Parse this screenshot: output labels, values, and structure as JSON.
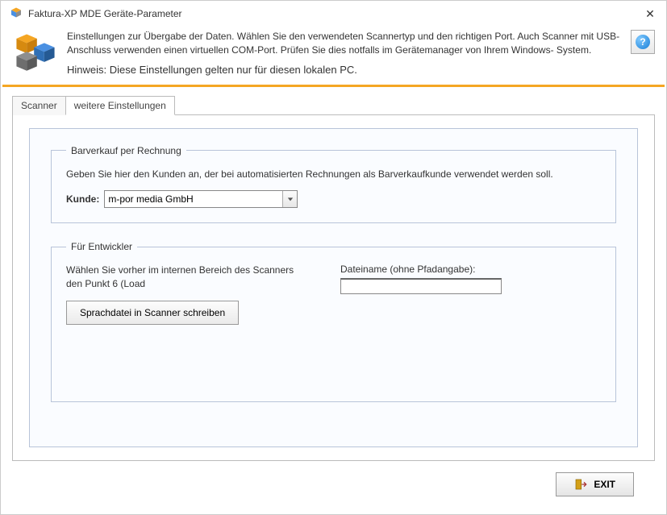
{
  "window": {
    "title": "Faktura-XP MDE Geräte-Parameter"
  },
  "header": {
    "desc": "Einstellungen zur Übergabe der Daten. Wählen Sie den verwendeten Scannertyp und den richtigen Port. Auch Scanner mit USB-Anschluss verwenden einen virtuellen COM-Port. Prüfen Sie dies notfalls im Gerätemanager von Ihrem Windows- System.",
    "hint": "Hinweis: Diese Einstellungen gelten nur für diesen lokalen PC."
  },
  "tabs": {
    "scanner": "Scanner",
    "settings": "weitere Einstellungen"
  },
  "barverkauf": {
    "legend": "Barverkauf per Rechnung",
    "desc": "Geben Sie hier den Kunden an, der bei automatisierten Rechnungen als Barverkaufkunde verwendet werden soll.",
    "kunde_label": "Kunde:",
    "kunde_value": "m-por media GmbH"
  },
  "developer": {
    "legend": "Für Entwickler",
    "left_desc": "Wählen Sie vorher im internen Bereich des Scanners den Punkt 6 (Load",
    "write_button": "Sprachdatei in Scanner schreiben",
    "filename_label": "Dateiname (ohne Pfadangabe):",
    "filename_value": ""
  },
  "footer": {
    "exit": "EXIT"
  }
}
